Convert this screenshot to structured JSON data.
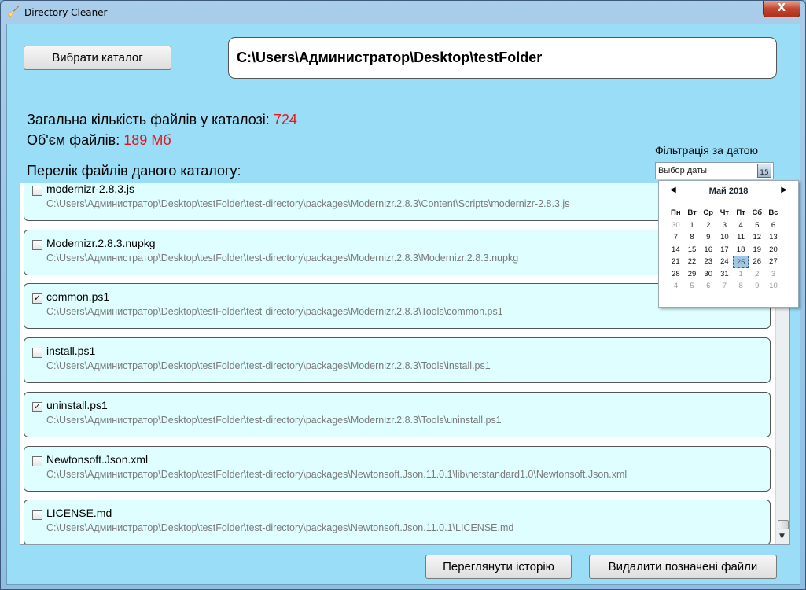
{
  "window": {
    "title": "Directory Cleaner",
    "close_glyph": "X"
  },
  "toolbar": {
    "choose_dir_label": "Вибрати каталог",
    "current_path": "C:\\Users\\Администратор\\Desktop\\testFolder"
  },
  "stats": {
    "count_label": "Загальна кількість файлів у каталозі:",
    "count_value": "724",
    "size_label": "Об'єм файлів:",
    "size_value": "189",
    "size_unit": "Мб",
    "list_label": "Перелік файлів даного каталогу:"
  },
  "filter": {
    "label": "Фільтрація за датою",
    "placeholder": "Выбор даты",
    "calendar_icon_text": "15"
  },
  "files": [
    {
      "name": "modernizr-2.8.3.js",
      "path": "C:\\Users\\Администратор\\Desktop\\testFolder\\test-directory\\packages\\Modernizr.2.8.3\\Content\\Scripts\\modernizr-2.8.3.js",
      "checked": false
    },
    {
      "name": "Modernizr.2.8.3.nupkg",
      "path": "C:\\Users\\Администратор\\Desktop\\testFolder\\test-directory\\packages\\Modernizr.2.8.3\\Modernizr.2.8.3.nupkg",
      "checked": false
    },
    {
      "name": "common.ps1",
      "path": "C:\\Users\\Администратор\\Desktop\\testFolder\\test-directory\\packages\\Modernizr.2.8.3\\Tools\\common.ps1",
      "checked": true
    },
    {
      "name": "install.ps1",
      "path": "C:\\Users\\Администратор\\Desktop\\testFolder\\test-directory\\packages\\Modernizr.2.8.3\\Tools\\install.ps1",
      "checked": false
    },
    {
      "name": "uninstall.ps1",
      "path": "C:\\Users\\Администратор\\Desktop\\testFolder\\test-directory\\packages\\Modernizr.2.8.3\\Tools\\uninstall.ps1",
      "checked": true
    },
    {
      "name": "Newtonsoft.Json.xml",
      "path": "C:\\Users\\Администратор\\Desktop\\testFolder\\test-directory\\packages\\Newtonsoft.Json.11.0.1\\lib\\netstandard1.0\\Newtonsoft.Json.xml",
      "checked": false
    },
    {
      "name": "LICENSE.md",
      "path": "C:\\Users\\Администратор\\Desktop\\testFolder\\test-directory\\packages\\Newtonsoft.Json.11.0.1\\LICENSE.md",
      "checked": false
    }
  ],
  "calendar": {
    "month_label": "Май 2018",
    "weekdays": [
      "Пн",
      "Вт",
      "Ср",
      "Чт",
      "Пт",
      "Сб",
      "Вс"
    ],
    "weeks": [
      [
        {
          "d": "30",
          "o": true
        },
        {
          "d": "1"
        },
        {
          "d": "2"
        },
        {
          "d": "3"
        },
        {
          "d": "4"
        },
        {
          "d": "5"
        },
        {
          "d": "6"
        }
      ],
      [
        {
          "d": "7"
        },
        {
          "d": "8"
        },
        {
          "d": "9"
        },
        {
          "d": "10"
        },
        {
          "d": "11"
        },
        {
          "d": "12"
        },
        {
          "d": "13"
        }
      ],
      [
        {
          "d": "14"
        },
        {
          "d": "15"
        },
        {
          "d": "16"
        },
        {
          "d": "17"
        },
        {
          "d": "18"
        },
        {
          "d": "19"
        },
        {
          "d": "20"
        }
      ],
      [
        {
          "d": "21"
        },
        {
          "d": "22"
        },
        {
          "d": "23"
        },
        {
          "d": "24"
        },
        {
          "d": "25",
          "t": true
        },
        {
          "d": "26"
        },
        {
          "d": "27"
        }
      ],
      [
        {
          "d": "28"
        },
        {
          "d": "29"
        },
        {
          "d": "30"
        },
        {
          "d": "31"
        },
        {
          "d": "1",
          "o": true
        },
        {
          "d": "2",
          "o": true
        },
        {
          "d": "3",
          "o": true
        }
      ],
      [
        {
          "d": "4",
          "o": true
        },
        {
          "d": "5",
          "o": true
        },
        {
          "d": "6",
          "o": true
        },
        {
          "d": "7",
          "o": true
        },
        {
          "d": "8",
          "o": true
        },
        {
          "d": "9",
          "o": true
        },
        {
          "d": "10",
          "o": true
        }
      ]
    ]
  },
  "actions": {
    "history_label": "Переглянути історію",
    "delete_label": "Видалити позначені файли"
  }
}
